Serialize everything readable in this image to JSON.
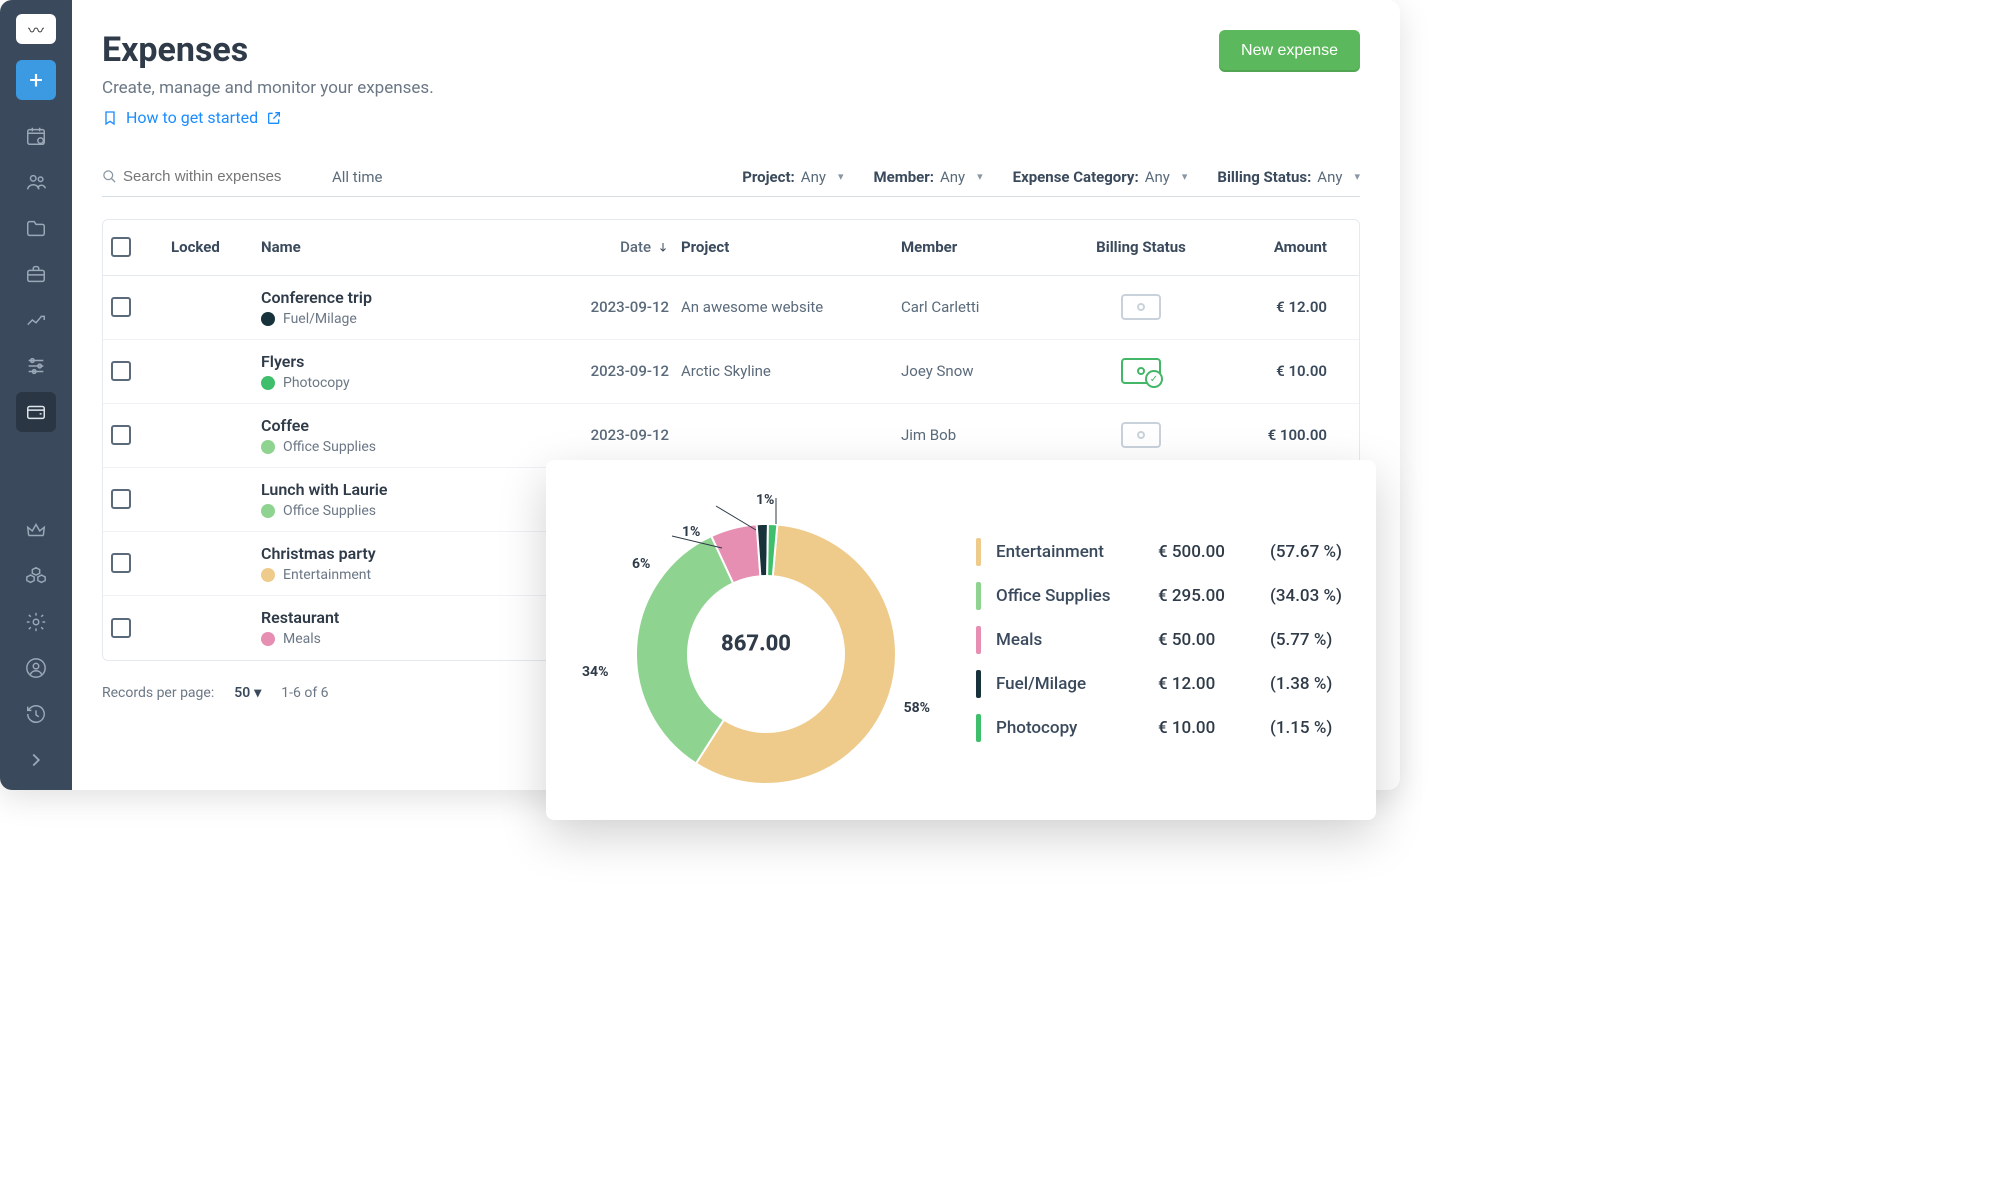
{
  "page": {
    "title": "Expenses",
    "subtitle": "Create, manage and monitor your expenses.",
    "help_link": "How to get started",
    "new_button": "New expense"
  },
  "filters": {
    "search_placeholder": "Search within expenses",
    "time": "All time",
    "project_label": "Project:",
    "project_value": "Any",
    "member_label": "Member:",
    "member_value": "Any",
    "category_label": "Expense Category:",
    "category_value": "Any",
    "billing_label": "Billing Status:",
    "billing_value": "Any"
  },
  "columns": {
    "locked": "Locked",
    "name": "Name",
    "date": "Date",
    "project": "Project",
    "member": "Member",
    "billing": "Billing Status",
    "amount": "Amount"
  },
  "rows": [
    {
      "name": "Conference trip",
      "category": "Fuel/Milage",
      "cat_color": "#17323a",
      "date": "2023-09-12",
      "project": "An awesome website",
      "member": "Carl Carletti",
      "billing": "gray",
      "amount": "€ 12.00"
    },
    {
      "name": "Flyers",
      "category": "Photocopy",
      "cat_color": "#3fbf6b",
      "date": "2023-09-12",
      "project": "Arctic Skyline",
      "member": "Joey Snow",
      "billing": "green",
      "amount": "€ 10.00"
    },
    {
      "name": "Coffee",
      "category": "Office Supplies",
      "cat_color": "#8fd391",
      "date": "2023-09-12",
      "project": "",
      "member": "Jim Bob",
      "billing": "gray",
      "amount": "€ 100.00"
    },
    {
      "name": "Lunch with Laurie",
      "category": "Office Supplies",
      "cat_color": "#8fd391",
      "date": "",
      "project": "",
      "member": "",
      "billing": "",
      "amount": ""
    },
    {
      "name": "Christmas party",
      "category": "Entertainment",
      "cat_color": "#eecb8b",
      "date": "",
      "project": "",
      "member": "",
      "billing": "",
      "amount": ""
    },
    {
      "name": "Restaurant",
      "category": "Meals",
      "cat_color": "#e78fb3",
      "date": "",
      "project": "",
      "member": "",
      "billing": "",
      "amount": ""
    }
  ],
  "footer": {
    "records_label": "Records per page:",
    "records_value": "50",
    "range": "1-6 of 6"
  },
  "chart_data": {
    "type": "pie",
    "title": "",
    "total": "867.00",
    "slice_labels": [
      "58%",
      "34%",
      "6%",
      "1%",
      "1%"
    ],
    "series": [
      {
        "name": "Entertainment",
        "value": 500.0,
        "percent": 57.67,
        "color": "#eecb8b",
        "amount_label": "€ 500.00",
        "pct_label": "(57.67 %)"
      },
      {
        "name": "Office Supplies",
        "value": 295.0,
        "percent": 34.03,
        "color": "#8fd391",
        "amount_label": "€ 295.00",
        "pct_label": "(34.03 %)"
      },
      {
        "name": "Meals",
        "value": 50.0,
        "percent": 5.77,
        "color": "#e78fb3",
        "amount_label": "€ 50.00",
        "pct_label": "(5.77 %)"
      },
      {
        "name": "Fuel/Milage",
        "value": 12.0,
        "percent": 1.38,
        "color": "#17323a",
        "amount_label": "€ 12.00",
        "pct_label": "(1.38 %)"
      },
      {
        "name": "Photocopy",
        "value": 10.0,
        "percent": 1.15,
        "color": "#3fbf6b",
        "amount_label": "€ 10.00",
        "pct_label": "(1.15 %)"
      }
    ]
  }
}
